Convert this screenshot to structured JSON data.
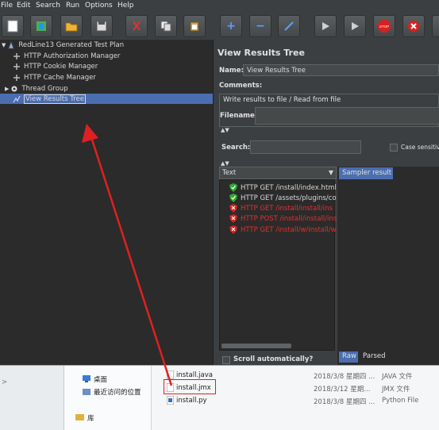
{
  "menu": {
    "file": "File",
    "edit": "Edit",
    "search": "Search",
    "run": "Run",
    "options": "Options",
    "help": "Help"
  },
  "tree": {
    "items": [
      {
        "label": "RedLine13 Generated Test Plan",
        "icon": "test-plan-icon"
      },
      {
        "label": "HTTP Authorization Manager",
        "icon": "config-icon"
      },
      {
        "label": "HTTP Cookie Manager",
        "icon": "config-icon"
      },
      {
        "label": "HTTP Cache Manager",
        "icon": "config-icon"
      },
      {
        "label": "Thread Group",
        "icon": "gear-icon"
      },
      {
        "label": "View Results Tree",
        "icon": "listener-icon"
      }
    ]
  },
  "panel": {
    "title": "View Results Tree",
    "name_label": "Name:",
    "name_value": "View Results Tree",
    "comments_label": "Comments:",
    "write_group": "Write results to file / Read from file",
    "filename_label": "Filename",
    "search_label": "Search:",
    "case_sensitive": "Case sensitive",
    "renderer": "Text",
    "sampler_tab": "Sampler result",
    "scroll_auto": "Scroll automatically?",
    "raw_tab": "Raw",
    "parsed_tab": "Parsed"
  },
  "results": [
    {
      "text": "HTTP GET /install/index.html",
      "status": "ok"
    },
    {
      "text": "HTTP GET /assets/plugins/co",
      "status": "ok"
    },
    {
      "text": "HTTP GET /install/install/ins",
      "status": "error"
    },
    {
      "text": "HTTP POST /install/install/ins",
      "status": "error"
    },
    {
      "text": "HTTP GET /install/w/install/w",
      "status": "error"
    }
  ],
  "explorer": {
    "desktop": "桌面",
    "recent": "最近访问的位置",
    "library": "库",
    "files": [
      {
        "name": "install.java",
        "date": "2018/3/8 星期四 ...",
        "type": "JAVA 文件"
      },
      {
        "name": "install.jmx",
        "date": "2018/3/12 星期...",
        "type": "JMX 文件"
      },
      {
        "name": "install.py",
        "date": "2018/3/8 星期四 ...",
        "type": "Python File"
      }
    ]
  },
  "colors": {
    "accent": "#4b6eaf",
    "ok": "#3fbf3f",
    "error": "#e03030",
    "arrow": "#e02020"
  }
}
